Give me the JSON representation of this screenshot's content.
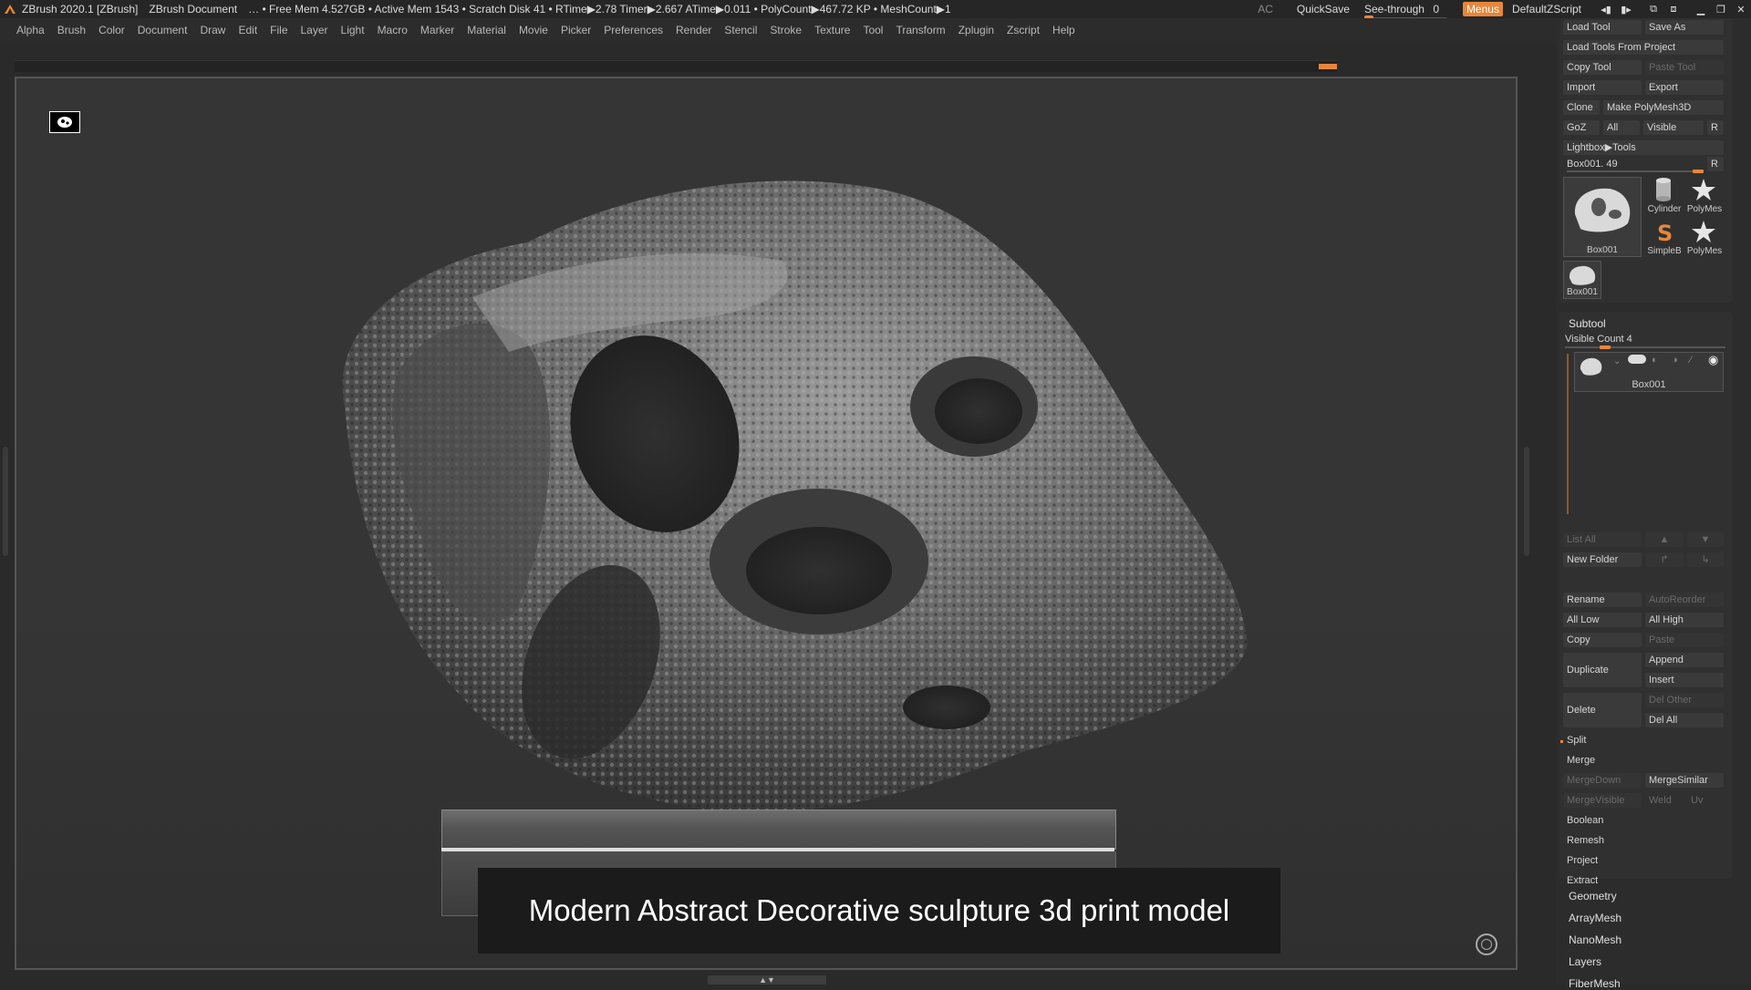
{
  "title_bar": {
    "app": "ZBrush 2020.1 [ZBrush]",
    "document": "ZBrush Document",
    "stats": "… • Free Mem 4.527GB • Active Mem 1543 • Scratch Disk 41 •  RTime▶2.78 Timer▶2.667 ATime▶0.011 • PolyCount▶467.72 KP  • MeshCount▶1",
    "ac": "AC",
    "quicksave": "QuickSave",
    "see_through_label": "See-through",
    "see_through_value": "0",
    "see_through_level": 0,
    "menus": "Menus",
    "zscript": "DefaultZScript"
  },
  "menu": [
    "Alpha",
    "Brush",
    "Color",
    "Document",
    "Draw",
    "Edit",
    "File",
    "Layer",
    "Light",
    "Macro",
    "Marker",
    "Material",
    "Movie",
    "Picker",
    "Preferences",
    "Render",
    "Stencil",
    "Stroke",
    "Texture",
    "Tool",
    "Transform",
    "Zplugin",
    "Zscript",
    "Help"
  ],
  "caption": "Modern Abstract Decorative sculpture 3d print model",
  "tool_panel": {
    "load_tool": "Load Tool",
    "save_as": "Save As",
    "load_from_project": "Load Tools From Project",
    "copy_tool": "Copy Tool",
    "paste_tool": "Paste Tool",
    "import": "Import",
    "export": "Export",
    "clone": "Clone",
    "make_polymesh": "Make PolyMesh3D",
    "goz": "GoZ",
    "all": "All",
    "visible": "Visible",
    "r": "R",
    "lightbox": "Lightbox▶Tools",
    "current_tool": "Box001. 49",
    "current_tool_level": 0.96,
    "thumbs": {
      "main": "Box001",
      "cylinder": "Cylinder",
      "polymesh1": "PolyMes",
      "simpleb": "SimpleB",
      "polymesh2": "PolyMes",
      "small": "Box001"
    }
  },
  "subtool": {
    "header": "Subtool",
    "visible_count": "Visible Count 4",
    "visible_count_level": 0.25,
    "item": "Box001",
    "list_all": "List All",
    "new_folder": "New Folder",
    "rename": "Rename",
    "autoreorder": "AutoReorder",
    "all_low": "All Low",
    "all_high": "All High",
    "copy": "Copy",
    "paste": "Paste",
    "duplicate": "Duplicate",
    "append": "Append",
    "insert": "Insert",
    "delete": "Delete",
    "del_other": "Del Other",
    "del_all": "Del All",
    "split": "Split",
    "merge": "Merge",
    "mergedown": "MergeDown",
    "mergesimilar": "MergeSimilar",
    "mergevisible": "MergeVisible",
    "weld": "Weld",
    "uv": "Uv",
    "boolean": "Boolean",
    "remesh": "Remesh",
    "project": "Project",
    "extract": "Extract"
  },
  "tray_sections": [
    "Geometry",
    "ArrayMesh",
    "NanoMesh",
    "Layers",
    "FiberMesh"
  ],
  "colors": {
    "accent": "#e8863a",
    "background": "#2a2a2a",
    "canvas": "#353535"
  }
}
